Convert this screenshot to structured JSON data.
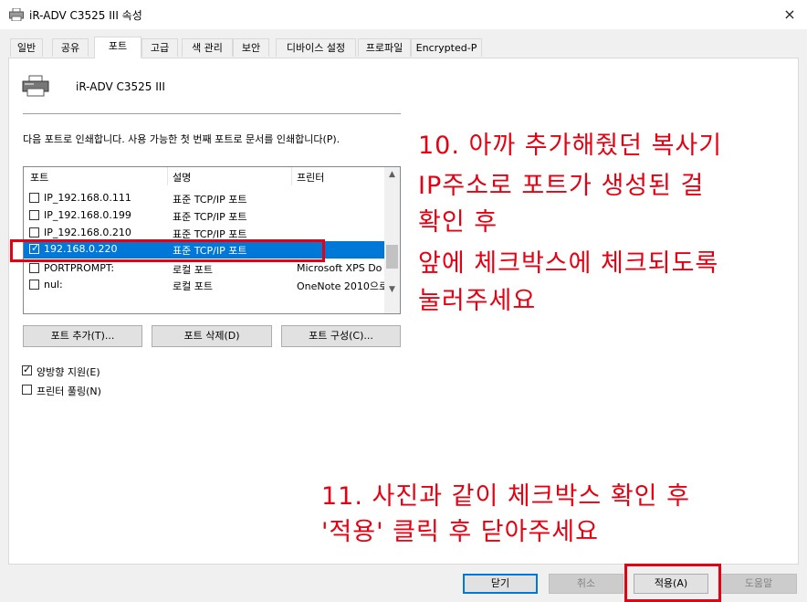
{
  "window": {
    "title": "iR-ADV C3525 III 속성",
    "close_icon": "×"
  },
  "tabs": [
    "일반",
    "공유",
    "포트",
    "고급",
    "색 관리",
    "보안",
    "디바이스 설정",
    "프로파일",
    "Encrypted-P"
  ],
  "printer_name": "iR-ADV C3525 III",
  "instruction": "다음 포트로 인쇄합니다. 사용 가능한 첫 번째 포트로 문서를 인쇄합니다(P).",
  "columns": [
    "포트",
    "설명",
    "프린터"
  ],
  "ports": [
    {
      "port": "IP_192.168.0.111",
      "desc": "표준 TCP/IP 포트",
      "printer": "",
      "checked": false,
      "selected": false
    },
    {
      "port": "IP_192.168.0.199",
      "desc": "표준 TCP/IP 포트",
      "printer": "",
      "checked": false,
      "selected": false
    },
    {
      "port": "IP_192.168.0.210",
      "desc": "표준 TCP/IP 포트",
      "printer": "",
      "checked": false,
      "selected": false
    },
    {
      "port": "192.168.0.220",
      "desc": "표준 TCP/IP 포트",
      "printer": "",
      "checked": true,
      "selected": true
    },
    {
      "port": "PORTPROMPT:",
      "desc": "로컬 포트",
      "printer": "Microsoft XPS Do",
      "checked": false,
      "selected": false
    },
    {
      "port": "nul:",
      "desc": "로컬 포트",
      "printer": "OneNote 2010으로",
      "checked": false,
      "selected": false
    }
  ],
  "buttons": {
    "add_port": "포트 추가(T)...",
    "delete_port": "포트 삭제(D)",
    "configure_port": "포트 구성(C)..."
  },
  "options": {
    "bidirectional": {
      "label": "양방향 지원(E)",
      "checked": true
    },
    "pooling": {
      "label": "프린터 풀링(N)",
      "checked": false
    }
  },
  "footer": {
    "ok": "닫기",
    "cancel": "취소",
    "apply": "적용(A)",
    "help": "도움말"
  },
  "annotations": {
    "step10": [
      "10. 아까 추가해줬던 복사기",
      "IP주소로 포트가 생성된 걸",
      "확인 후",
      "앞에 체크박스에 체크되도록",
      "눌러주세요"
    ],
    "step11": [
      "11. 사진과 같이 체크박스 확인 후",
      "'적용' 클릭 후 닫아주세요"
    ]
  },
  "colors": {
    "selection": "#0078d7",
    "annotation": "#e60012"
  }
}
